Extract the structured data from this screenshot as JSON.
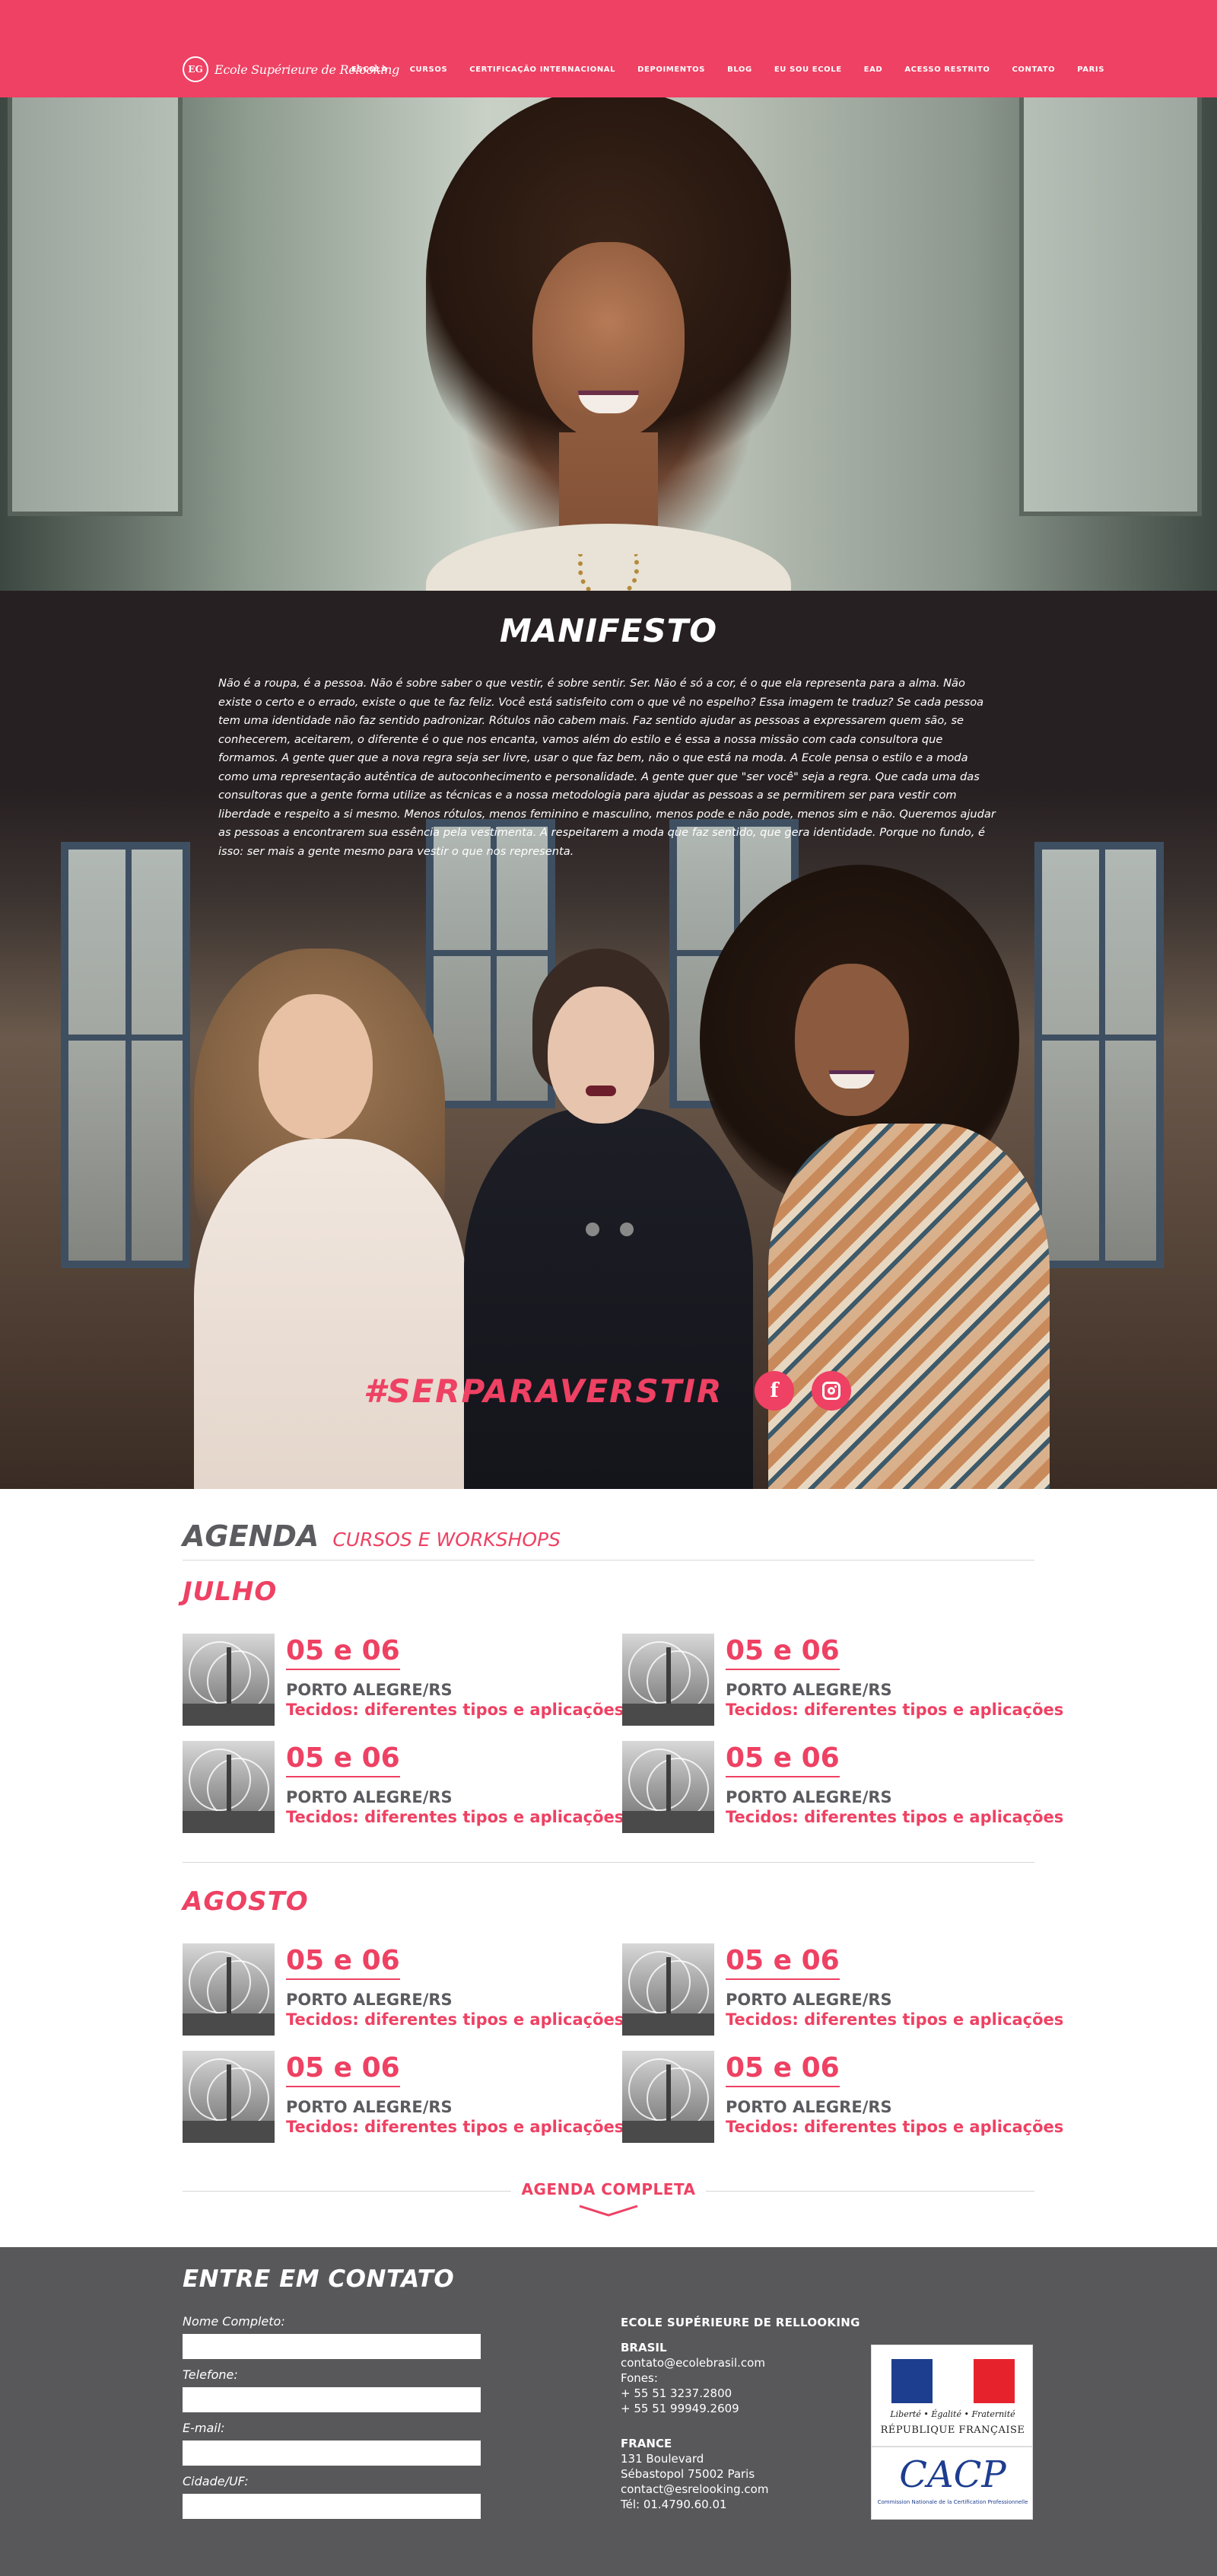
{
  "header": {
    "logo_mark": "EG",
    "logo_text": "Ecole Supérieure de Relooking",
    "nav": [
      "ESCOLA",
      "CURSOS",
      "CERTIFICAÇÃO INTERNACIONAL",
      "DEPOIMENTOS",
      "BLOG",
      "EU SOU ECOLE",
      "EAD",
      "ACESSO RESTRITO",
      "CONTATO",
      "PARIS"
    ]
  },
  "manifesto": {
    "title": "MANIFESTO",
    "text": "Não é a roupa, é a pessoa. Não é sobre saber o que vestir, é sobre sentir. Ser. Não é só a cor, é o que ela representa para a alma. Não existe o certo e o errado, existe o que te faz feliz. Você está satisfeito com o que vê no espelho? Essa imagem te traduz? Se cada pessoa tem uma identidade não faz sentido padronizar. Rótulos não cabem mais. Faz sentido ajudar as pessoas a expressarem quem são, se conhecerem, aceitarem, o diferente é o que nos encanta, vamos além do estilo e é essa a nossa missão com cada consultora que formamos. A gente quer que a nova regra seja ser livre, usar o que faz bem, não o que está na moda. A Ecole pensa o estilo e a moda como uma representação autêntica de autoconhecimento e personalidade. A gente quer que \"ser você\" seja a regra. Que cada uma das consultoras que a gente forma utilize as técnicas e a nossa metodologia para ajudar as pessoas a se permitirem ser para vestir com liberdade e respeito a si mesmo. Menos rótulos, menos feminino e masculino, menos pode e não pode, menos sim e não. Queremos ajudar as pessoas a encontrarem sua essência pela vestimenta. A respeitarem a moda que faz sentido, que gera identidade. Porque no fundo, é isso: ser mais a gente mesmo para vestir o que nos representa.",
    "hashtag": "#SERPARAVERSTIR",
    "facebook_glyph": "f"
  },
  "agenda": {
    "title": "AGENDA",
    "subtitle": "CURSOS E WORKSHOPS",
    "months": [
      {
        "name": "JULHO",
        "events": [
          {
            "date": "05 e 06",
            "city": "PORTO ALEGRE/RS",
            "topic": "Tecidos: diferentes tipos e aplicações"
          },
          {
            "date": "05 e 06",
            "city": "PORTO ALEGRE/RS",
            "topic": "Tecidos: diferentes tipos e aplicações"
          },
          {
            "date": "05 e 06",
            "city": "PORTO ALEGRE/RS",
            "topic": "Tecidos: diferentes tipos e aplicações"
          },
          {
            "date": "05 e 06",
            "city": "PORTO ALEGRE/RS",
            "topic": "Tecidos: diferentes tipos e aplicações"
          }
        ]
      },
      {
        "name": "AGOSTO",
        "events": [
          {
            "date": "05 e 06",
            "city": "PORTO ALEGRE/RS",
            "topic": "Tecidos: diferentes tipos e aplicações"
          },
          {
            "date": "05 e 06",
            "city": "PORTO ALEGRE/RS",
            "topic": "Tecidos: diferentes tipos e aplicações"
          },
          {
            "date": "05 e 06",
            "city": "PORTO ALEGRE/RS",
            "topic": "Tecidos: diferentes tipos e aplicações"
          },
          {
            "date": "05 e 06",
            "city": "PORTO ALEGRE/RS",
            "topic": "Tecidos: diferentes tipos e aplicações"
          }
        ]
      }
    ],
    "link_label": "AGENDA COMPLETA"
  },
  "contact": {
    "title": "ENTRE EM CONTATO",
    "fields": [
      {
        "label": "Nome Completo:",
        "value": ""
      },
      {
        "label": "Telefone:",
        "value": ""
      },
      {
        "label": "E-mail:",
        "value": ""
      },
      {
        "label": "Cidade/UF:",
        "value": ""
      }
    ],
    "school_name": "ECOLE SUPÉRIEURE DE RELLOOKING",
    "brasil": {
      "heading": "BRASIL",
      "email": "contato@ecolebrasil.com",
      "phones_label": "Fones:",
      "phone1": "+ 55 51 3237.2800",
      "phone2": "+ 55 51 99949.2609"
    },
    "france": {
      "heading": "FRANCE",
      "address1": "131 Boulevard",
      "address2": "Sébastopol 75002 Paris",
      "email": "contact@esrelooking.com",
      "phone": "Tél: 01.4790.60.01"
    },
    "badges": {
      "rf_motto": "Liberté • Égalité • Fraternité",
      "rf_name": "RÉPUBLIQUE FRANÇAISE",
      "cacp": "CACP",
      "cacp_sub": "Commission Nationale de la Certification Professionnelle"
    }
  },
  "colors": {
    "accent": "#ee4163",
    "dark": "#58585b",
    "manifesto_bg": "#272022"
  }
}
